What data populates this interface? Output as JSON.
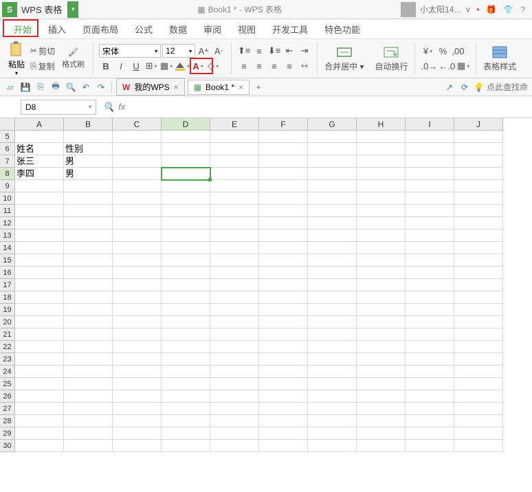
{
  "app": {
    "name": "WPS 表格",
    "doc_title": "Book1 * - WPS 表格"
  },
  "user": {
    "name": "小太阳14..."
  },
  "menus": {
    "items": [
      "开始",
      "插入",
      "页面布局",
      "公式",
      "数据",
      "审阅",
      "视图",
      "开发工具",
      "特色功能"
    ],
    "active_index": 0
  },
  "clipboard": {
    "paste": "粘贴",
    "cut": "剪切",
    "copy": "复制",
    "format_painter": "格式刷"
  },
  "font": {
    "name": "宋体",
    "size": "12"
  },
  "merge": "合并居中",
  "wrap": "自动换行",
  "table_style": "表格样式",
  "quickbar": {
    "my_wps": "我的WPS",
    "doc": "Book1 *",
    "click_here": "点此查找命"
  },
  "namebox": "D8",
  "columns": [
    "A",
    "B",
    "C",
    "D",
    "E",
    "F",
    "G",
    "H",
    "I",
    "J"
  ],
  "rows_start": 5,
  "rows_end": 30,
  "cells": {
    "A6": "姓名",
    "B6": "性别",
    "A7": "张三",
    "B7": "男",
    "A8": "李四",
    "B8": "男"
  },
  "active_cell": {
    "col": "D",
    "row": 8
  }
}
